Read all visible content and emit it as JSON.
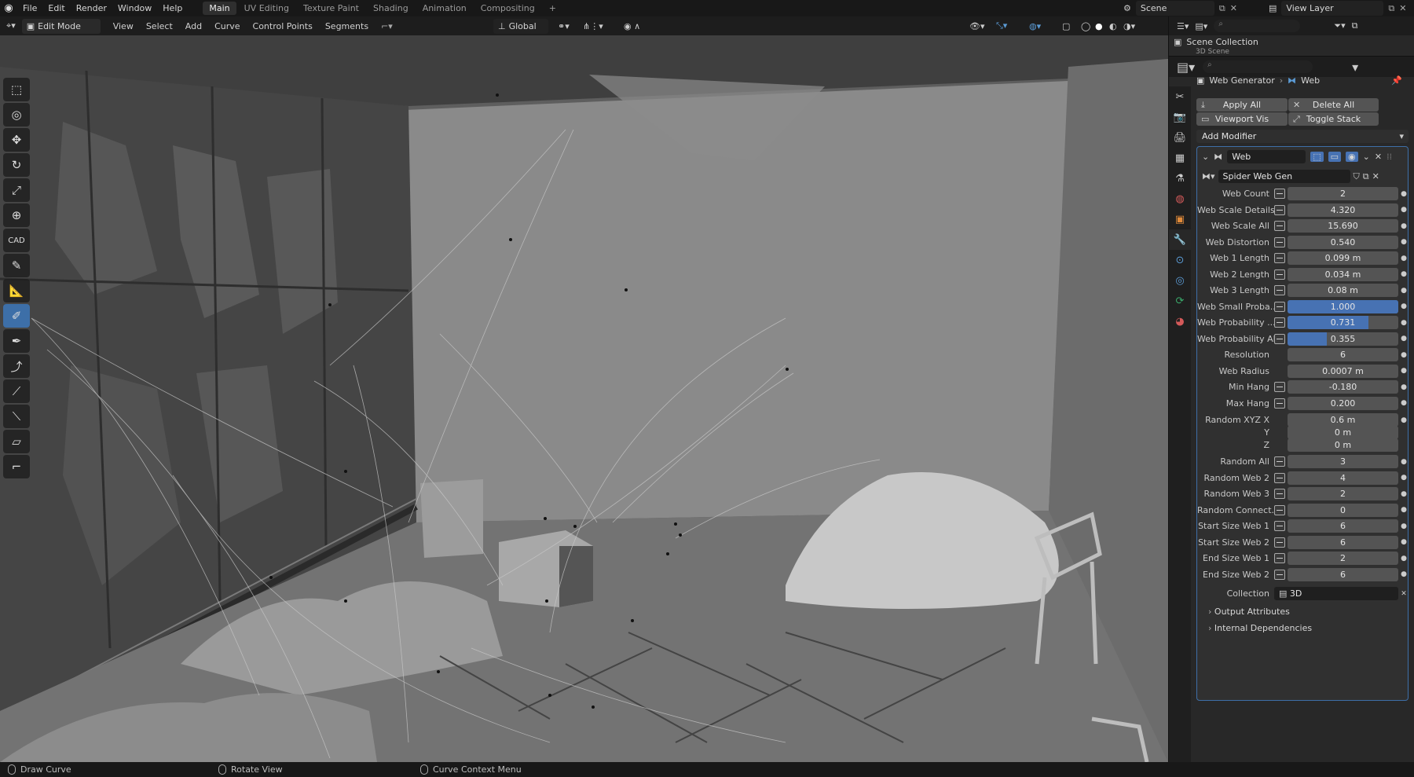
{
  "topbar": {
    "menus": [
      "File",
      "Edit",
      "Render",
      "Window",
      "Help"
    ],
    "workspaces": [
      "Main",
      "UV Editing",
      "Texture Paint",
      "Shading",
      "Animation",
      "Compositing"
    ],
    "active_workspace": "Main",
    "plus": "+",
    "scene_label": "Scene",
    "view_layer_label": "View Layer"
  },
  "viewport_header": {
    "mode": "Edit Mode",
    "menus": [
      "View",
      "Select",
      "Add",
      "Curve",
      "Control Points",
      "Segments"
    ],
    "transform_orientation": "Global"
  },
  "toolbar": {
    "tools": [
      {
        "name": "select-box-tool",
        "glyph": "⬚",
        "active": false
      },
      {
        "name": "cursor-tool",
        "glyph": "◎",
        "active": false
      },
      {
        "name": "move-tool",
        "glyph": "✥",
        "active": false
      },
      {
        "name": "rotate-tool",
        "glyph": "↻",
        "active": false
      },
      {
        "name": "scale-tool",
        "glyph": "⤢",
        "active": false
      },
      {
        "name": "transform-tool",
        "glyph": "⊕",
        "active": false
      },
      {
        "name": "cad-tool",
        "glyph": "CAD",
        "active": false
      },
      {
        "name": "annotate-tool",
        "glyph": "✎",
        "active": false
      },
      {
        "name": "measure-tool",
        "glyph": "📐",
        "active": false
      },
      {
        "name": "draw-curve-tool",
        "glyph": "✐",
        "active": true
      },
      {
        "name": "pen-tool",
        "glyph": "✒",
        "active": false
      },
      {
        "name": "extrude-tool",
        "glyph": "⤴",
        "active": false
      },
      {
        "name": "radius-tool",
        "glyph": "⟋",
        "active": false
      },
      {
        "name": "tilt-tool",
        "glyph": "⟍",
        "active": false
      },
      {
        "name": "randomize-tool",
        "glyph": "▱",
        "active": false
      },
      {
        "name": "curve-pen-tool",
        "glyph": "⌐",
        "active": false
      }
    ]
  },
  "outliner": {
    "title": "Scene Collection",
    "child": "3D Scene"
  },
  "properties": {
    "breadcrumb_object": "Web Generator",
    "breadcrumb_modifier": "Web",
    "apply_all": "Apply All",
    "delete_all": "Delete All",
    "viewport_vis": "Viewport Vis",
    "toggle_stack": "Toggle Stack",
    "add_modifier": "Add Modifier",
    "modifier_name": "Web",
    "node_group": "Spider Web Gen",
    "params": [
      {
        "label": "Web Count",
        "value": "2",
        "keyframe": true,
        "fill": 0
      },
      {
        "label": "Web Scale Details",
        "value": "4.320",
        "keyframe": true,
        "fill": 0
      },
      {
        "label": "Web Scale All",
        "value": "15.690",
        "keyframe": true,
        "fill": 0
      },
      {
        "label": "Web Distortion",
        "value": "0.540",
        "keyframe": true,
        "fill": 0
      },
      {
        "label": "Web 1 Length",
        "value": "0.099 m",
        "keyframe": true,
        "fill": 0
      },
      {
        "label": "Web 2 Length",
        "value": "0.034 m",
        "keyframe": true,
        "fill": 0
      },
      {
        "label": "Web 3 Length",
        "value": "0.08 m",
        "keyframe": true,
        "fill": 0
      },
      {
        "label": "Web Small Proba...",
        "value": "1.000",
        "keyframe": true,
        "fill": 1.0
      },
      {
        "label": "Web Probability ...",
        "value": "0.731",
        "keyframe": true,
        "fill": 0.731
      },
      {
        "label": "Web Probability All",
        "value": "0.355",
        "keyframe": true,
        "fill": 0.355
      },
      {
        "label": "Resolution",
        "value": "6",
        "keyframe": false,
        "fill": 0
      },
      {
        "label": "Web Radius",
        "value": "0.0007 m",
        "keyframe": false,
        "fill": 0
      },
      {
        "label": "Min Hang",
        "value": "-0.180",
        "keyframe": true,
        "fill": 0
      },
      {
        "label": "Max Hang",
        "value": "0.200",
        "keyframe": true,
        "fill": 0
      }
    ],
    "random_xyz": {
      "label": "Random XYZ X",
      "x": "0.6 m",
      "y_label": "Y",
      "y": "0 m",
      "z_label": "Z",
      "z": "0 m"
    },
    "params2": [
      {
        "label": "Random All",
        "value": "3"
      },
      {
        "label": "Random Web 2",
        "value": "4"
      },
      {
        "label": "Random Web 3",
        "value": "2"
      },
      {
        "label": "Random Connect...",
        "value": "0"
      },
      {
        "label": "Start Size Web 1",
        "value": "6"
      },
      {
        "label": "Start Size Web 2",
        "value": "6"
      },
      {
        "label": "End Size Web 1",
        "value": "2"
      },
      {
        "label": "End Size Web 2",
        "value": "6"
      }
    ],
    "collection_label": "Collection",
    "collection_value": "3D",
    "output_attributes": "Output Attributes",
    "internal_dependencies": "Internal Dependencies"
  },
  "statusbar": {
    "left": "Draw Curve",
    "middle": "Rotate View",
    "right": "Curve Context Menu"
  },
  "colors": {
    "accent": "#4772b3",
    "panel_bg": "#282828",
    "field_bg": "#545454"
  }
}
